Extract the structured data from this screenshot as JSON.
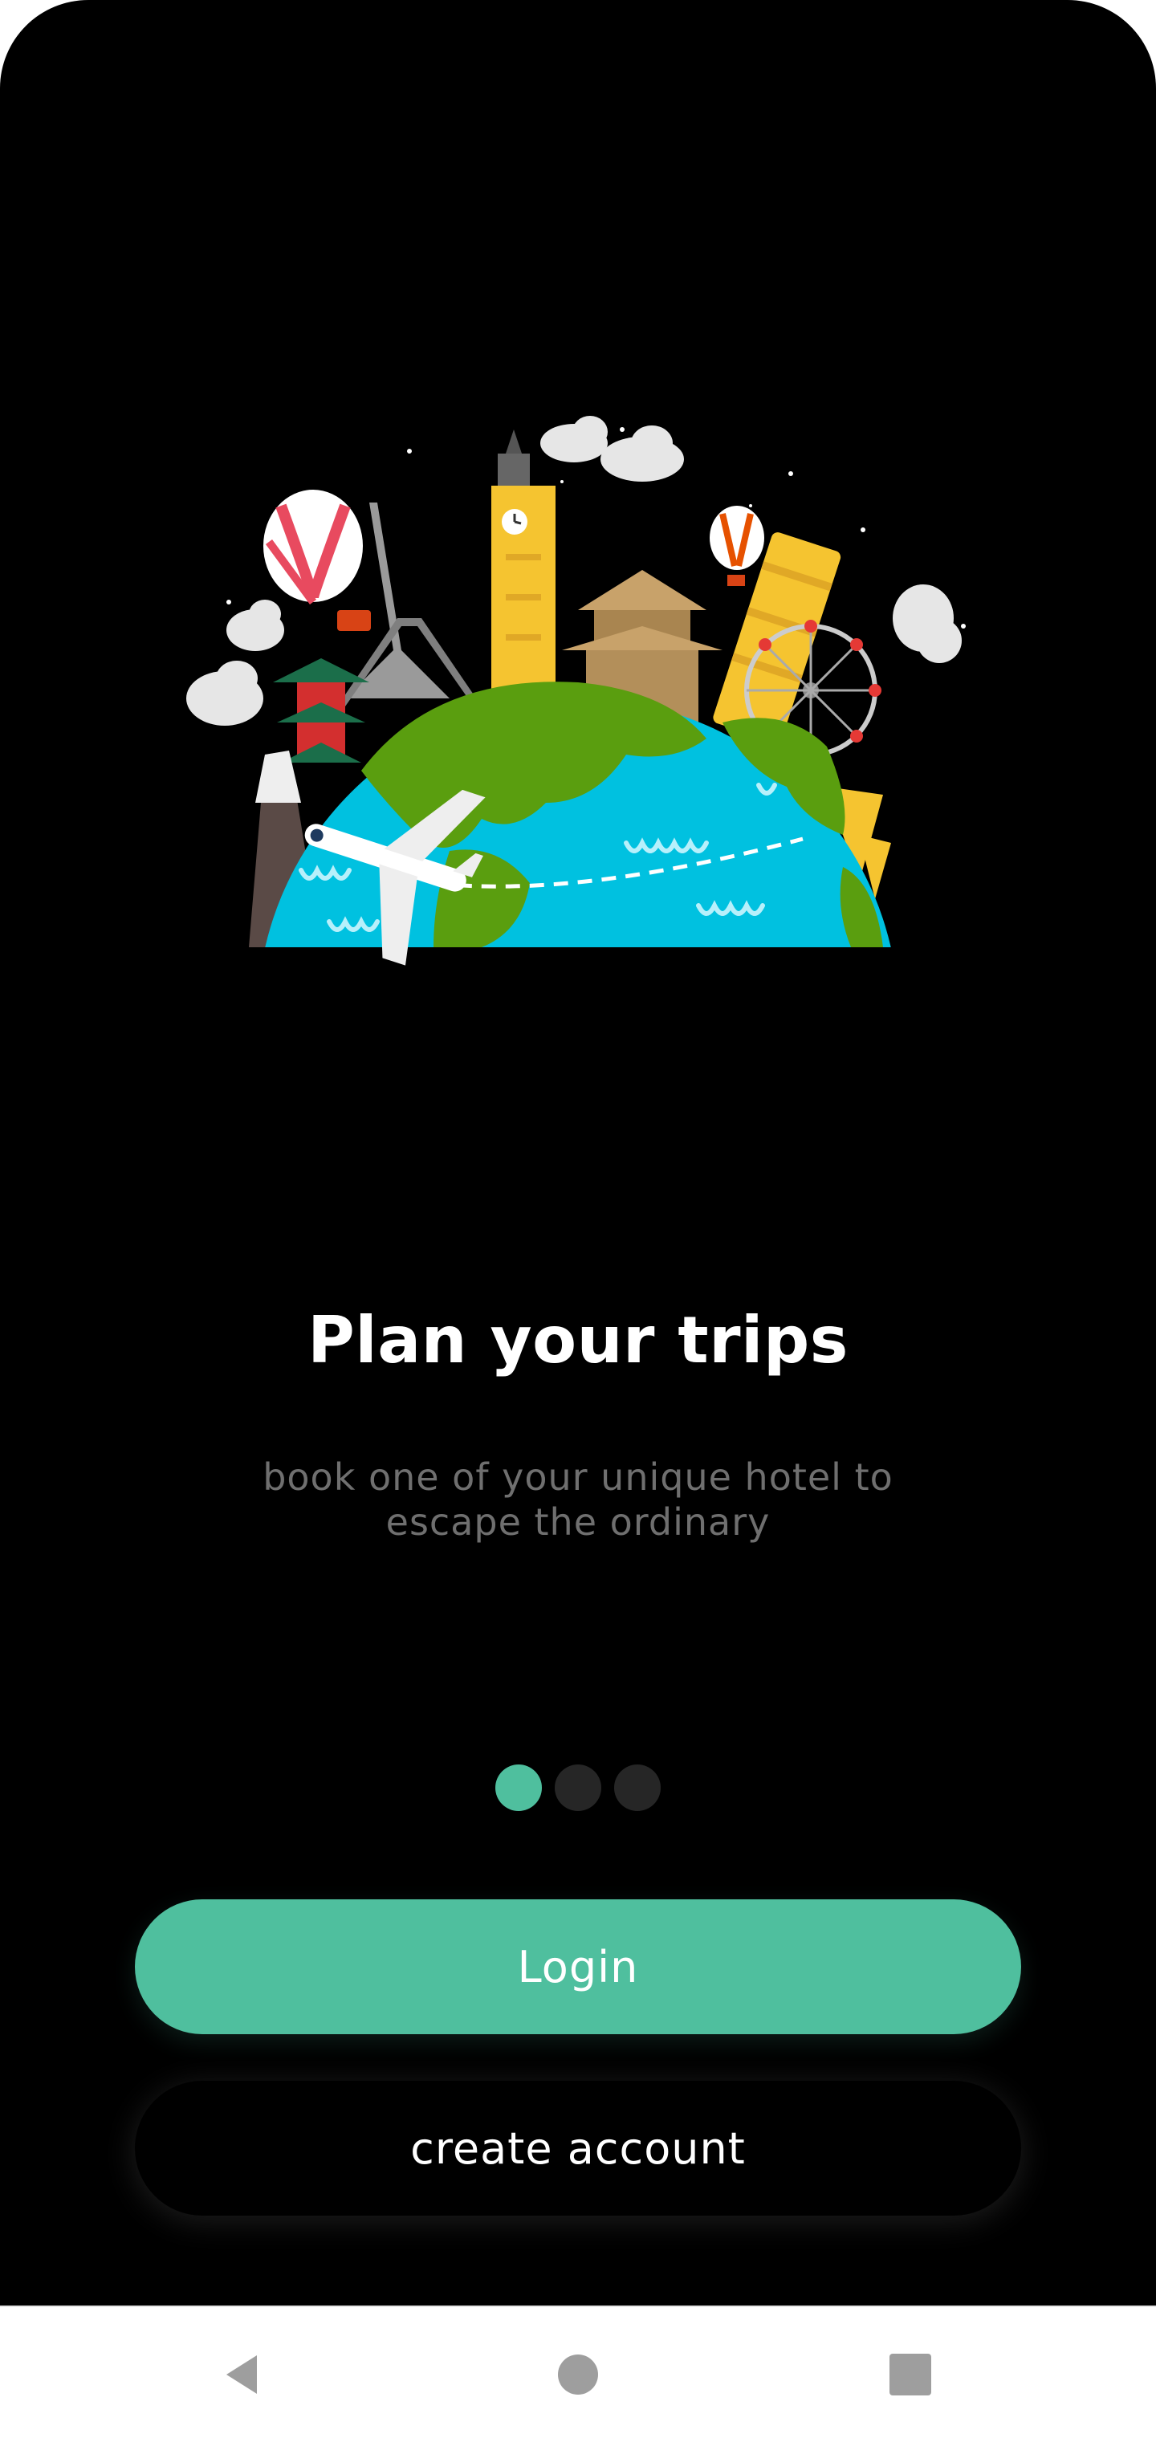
{
  "onboarding": {
    "title": "Plan your trips",
    "subtitle": "book one of your unique hotel to escape the ordinary",
    "page_indicator": {
      "total": 3,
      "active_index": 0
    }
  },
  "actions": {
    "login_label": "Login",
    "create_account_label": "create account"
  },
  "system_nav": {
    "back_icon": "back-triangle",
    "home_icon": "home-circle",
    "recents_icon": "recents-square"
  },
  "colors": {
    "accent": "#4fbf9e",
    "background": "#000000",
    "subtitle_text": "#6f6f6f",
    "inactive_dot": "#262626",
    "nav_icon": "#9e9e9e"
  }
}
